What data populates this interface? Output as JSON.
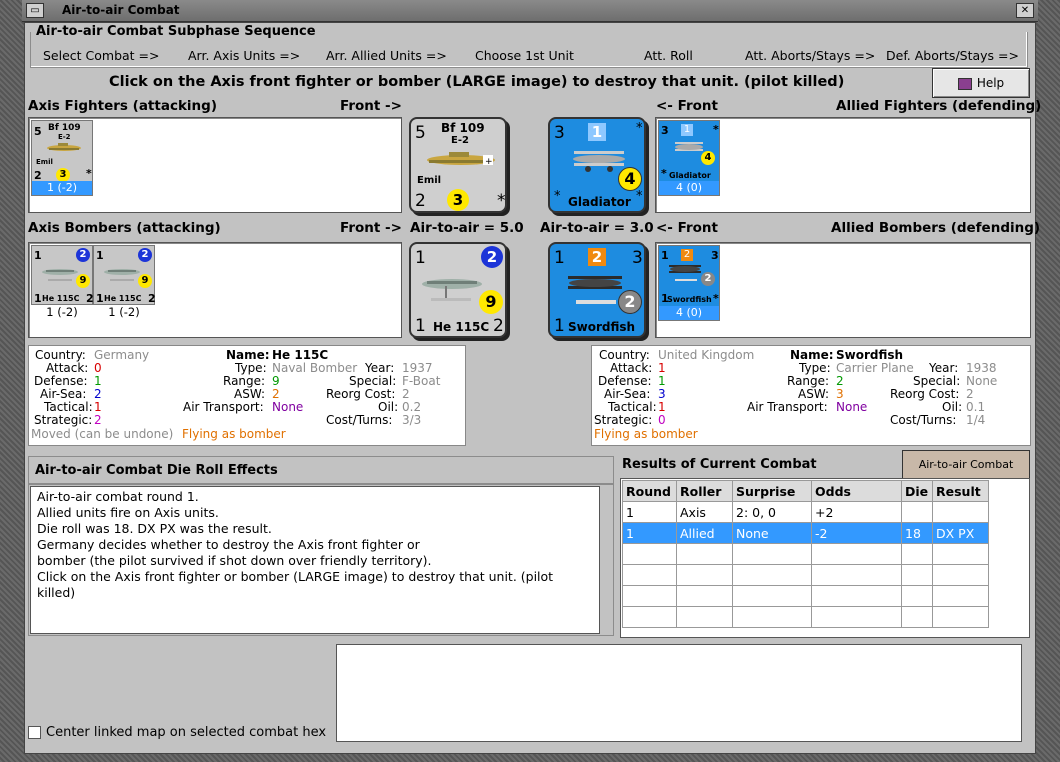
{
  "window": {
    "title": "Air-to-air Combat"
  },
  "sequence": {
    "label": "Air-to-air Combat Subphase Sequence",
    "steps": [
      "Select Combat =>",
      "Arr. Axis Units =>",
      "Arr. Allied Units =>",
      "Choose 1st Unit",
      "Att. Roll",
      "Att. Aborts/Stays =>",
      "Def. Aborts/Stays =>"
    ]
  },
  "instruction": "Click on the Axis front fighter or bomber (LARGE image) to destroy that unit. (pilot killed)",
  "help_label": "Help",
  "headers": {
    "axis_fighters": "Axis Fighters (attacking)",
    "front_right_1": "Front ->",
    "front_left_1": "<- Front",
    "allied_fighters": "Allied Fighters (defending)",
    "axis_bombers": "Axis Bombers (attacking)",
    "front_right_2": "Front ->",
    "axis_air_to_air": "Air-to-air = 5.0",
    "allied_air_to_air": "Air-to-air = 3.0",
    "front_left_2": "<- Front",
    "allied_bombers": "Allied Bombers (defending)"
  },
  "axis_fighters": [
    {
      "name": "Bf 109",
      "variant": "E-2",
      "nickname": "Emil",
      "attack": "5",
      "defense": "2",
      "range": "3",
      "star": "*",
      "value": "1 (-2)"
    }
  ],
  "axis_fighter_big": {
    "name": "Bf 109",
    "variant": "E-2",
    "nickname": "Emil",
    "attack": "5",
    "defense": "2",
    "range": "3",
    "star": "*"
  },
  "allied_fighter_big": {
    "name": "Gladiator",
    "attack": "3",
    "air_sea": "1",
    "range": "4",
    "star": "*"
  },
  "allied_fighters": [
    {
      "name": "Gladiator",
      "attack": "3",
      "air_sea": "1",
      "range": "4",
      "star": "*",
      "value": "4 (0)"
    }
  ],
  "axis_bombers": [
    {
      "name": "He 115C",
      "attack": "1",
      "air_sea": "2",
      "range": "9",
      "defense": "2",
      "star": "1",
      "value": "1 (-2)"
    },
    {
      "name": "He 115C",
      "attack": "1",
      "air_sea": "2",
      "range": "9",
      "defense": "2",
      "star": "1",
      "value": "1 (-2)"
    }
  ],
  "axis_bomber_big": {
    "name": "He 115C",
    "attack": "1",
    "air_sea": "2",
    "range": "9",
    "defense": "2",
    "tactical": "1"
  },
  "allied_bomber_big": {
    "name": "Swordfish",
    "attack": "1",
    "air_sea": "2",
    "range": "2",
    "defense": "3",
    "tactical": "1"
  },
  "allied_bombers": [
    {
      "name": "Swordfish",
      "attack": "1",
      "air_sea": "2",
      "range": "2",
      "defense": "3",
      "star": "*",
      "value": "4 (0)"
    }
  ],
  "axis_info": {
    "country_label": "Country:",
    "country": "Germany",
    "name_label": "Name:",
    "name": "He 115C",
    "attack_label": "Attack:",
    "attack": "0",
    "type_label": "Type:",
    "type": "Naval Bomber",
    "year_label": "Year:",
    "year": "1937",
    "defense_label": "Defense:",
    "defense": "1",
    "range_label": "Range:",
    "range": "9",
    "special_label": "Special:",
    "special": "F-Boat",
    "air_sea_label": "Air-Sea:",
    "air_sea": "2",
    "asw_label": "ASW:",
    "asw": "2",
    "reorg_label": "Reorg Cost:",
    "reorg": "2",
    "tactical_label": "Tactical:",
    "tactical": "1",
    "air_transport_label": "Air Transport:",
    "air_transport": "None",
    "oil_label": "Oil:",
    "oil": "0.2",
    "strategic_label": "Strategic:",
    "strategic": "2",
    "cost_label": "Cost/Turns:",
    "cost": "3/3",
    "moved": "Moved (can be undone)",
    "flying": "Flying as bomber"
  },
  "allied_info": {
    "country_label": "Country:",
    "country": "United Kingdom",
    "name_label": "Name:",
    "name": "Swordfish",
    "attack_label": "Attack:",
    "attack": "1",
    "type_label": "Type:",
    "type": "Carrier Plane",
    "year_label": "Year:",
    "year": "1938",
    "defense_label": "Defense:",
    "defense": "1",
    "range_label": "Range:",
    "range": "2",
    "special_label": "Special:",
    "special": "None",
    "air_sea_label": "Air-Sea:",
    "air_sea": "3",
    "asw_label": "ASW:",
    "asw": "3",
    "reorg_label": "Reorg Cost:",
    "reorg": "2",
    "tactical_label": "Tactical:",
    "tactical": "1",
    "air_transport_label": "Air Transport:",
    "air_transport": "None",
    "oil_label": "Oil:",
    "oil": "0.1",
    "strategic_label": "Strategic:",
    "strategic": "0",
    "cost_label": "Cost/Turns:",
    "cost": "1/4",
    "flying": "Flying as bomber"
  },
  "die_roll": {
    "title": "Air-to-air Combat Die Roll Effects",
    "lines": [
      "Air-to-air combat round 1.",
      "Allied units fire on Axis units.",
      "Die roll was 18.  DX PX was the result.",
      "Germany decides whether to destroy the Axis front fighter or",
      "bomber (the pilot survived if shot down over friendly territory).",
      "Click on the Axis front fighter or bomber (LARGE image) to destroy that unit. (pilot",
      "killed)"
    ]
  },
  "results": {
    "title": "Results of Current Combat",
    "chart_button": "Air-to-air Combat Chart",
    "columns": [
      "Round",
      "Roller",
      "Surprise",
      "Odds",
      "Die",
      "Result"
    ],
    "rows": [
      [
        "1",
        "Axis",
        "2: 0, 0",
        "+2",
        "",
        ""
      ],
      [
        "1",
        "Allied",
        "None",
        "-2",
        "18",
        "DX PX"
      ]
    ]
  },
  "center_map_label": "Center linked map on selected combat hex"
}
